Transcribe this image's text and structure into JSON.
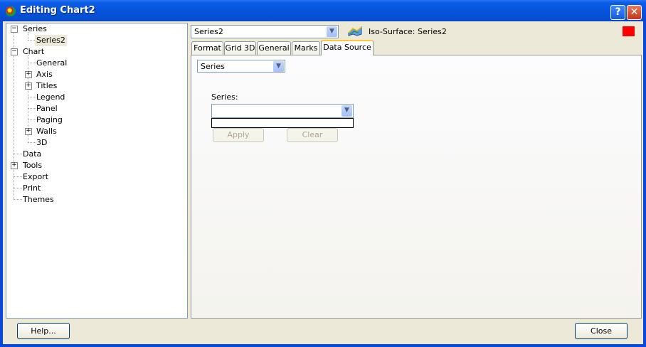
{
  "window": {
    "title": "Editing Chart2"
  },
  "tree": {
    "items": [
      {
        "label": "Series"
      },
      {
        "label": "Series2"
      },
      {
        "label": "Chart"
      },
      {
        "label": "General"
      },
      {
        "label": "Axis"
      },
      {
        "label": "Titles"
      },
      {
        "label": "Legend"
      },
      {
        "label": "Panel"
      },
      {
        "label": "Paging"
      },
      {
        "label": "Walls"
      },
      {
        "label": "3D"
      },
      {
        "label": "Data"
      },
      {
        "label": "Tools"
      },
      {
        "label": "Export"
      },
      {
        "label": "Print"
      },
      {
        "label": "Themes"
      }
    ]
  },
  "series_selector": {
    "value": "Series2",
    "type_label": "Iso-Surface: Series2",
    "color": "#ff0000"
  },
  "tabs": [
    {
      "label": "Format"
    },
    {
      "label": "Grid 3D"
    },
    {
      "label": "General"
    },
    {
      "label": "Marks"
    },
    {
      "label": "Data Source"
    }
  ],
  "data_source": {
    "source_type": "Series",
    "series_label": "Series:",
    "series_value": "",
    "apply_label": "Apply",
    "clear_label": "Clear"
  },
  "footer": {
    "help_label": "Help...",
    "close_label": "Close"
  }
}
